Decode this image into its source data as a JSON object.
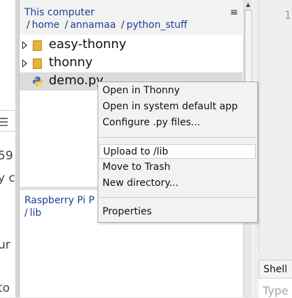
{
  "left_fragments": {
    "frag1": "59",
    "frag2": "y c",
    "frag3": "ur",
    "frag4": "to"
  },
  "files_panel": {
    "title": "This computer",
    "path": [
      "home",
      "annamaa",
      "python_stuff"
    ],
    "tree": [
      {
        "label": "easy-thonny",
        "type": "folder"
      },
      {
        "label": "thonny",
        "type": "folder"
      },
      {
        "label": "demo.py",
        "type": "python-file",
        "selected": true
      }
    ],
    "lower_title": "Raspberry Pi P",
    "lower_path": [
      "lib"
    ]
  },
  "editor": {
    "line_number": "1"
  },
  "shell": {
    "tab_label": "Shell",
    "placeholder": "Type"
  },
  "context_menu": {
    "items": [
      {
        "label": "Open in Thonny"
      },
      {
        "label": "Open in system default app"
      },
      {
        "label": "Configure .py files..."
      },
      {
        "label": "Upload to /lib",
        "highlighted": true
      },
      {
        "label": "Move to Trash"
      },
      {
        "label": "New directory..."
      },
      {
        "label": "Properties"
      }
    ]
  }
}
